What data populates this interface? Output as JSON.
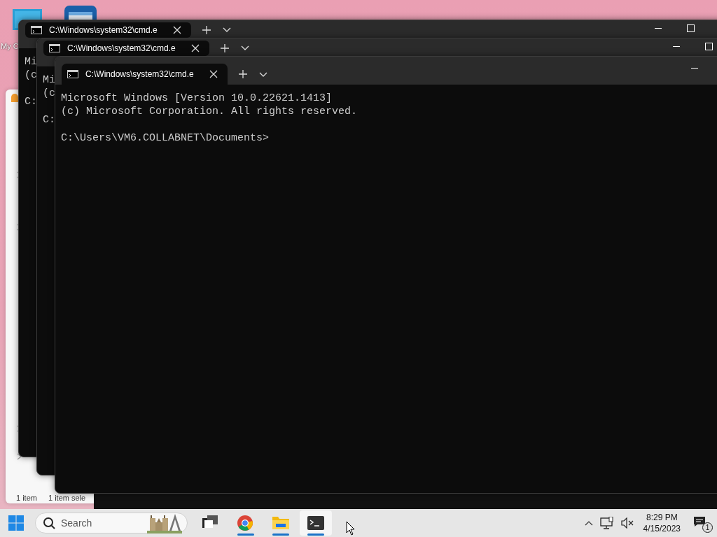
{
  "desktop": {
    "icons": [
      {
        "kind": "monitor",
        "label": "My C"
      },
      {
        "kind": "app"
      }
    ]
  },
  "explorer": {
    "status_items": [
      "1 item",
      "1 item sele"
    ]
  },
  "windows": [
    {
      "tabs": [
        {
          "title": "C:\\Windows\\system32\\cmd.e",
          "selected": true
        }
      ],
      "buttons": [
        {
          "kind": "minimize"
        },
        {
          "kind": "maximize"
        }
      ],
      "banner": [
        "Mi",
        "(c"
      ],
      "prompt": "C:"
    },
    {
      "tabs": [
        {
          "title": "C:\\Windows\\system32\\cmd.e",
          "selected": true
        }
      ],
      "buttons": [
        {
          "kind": "minimize"
        },
        {
          "kind": "maximize"
        }
      ],
      "banner": [
        "Mi",
        "(c"
      ],
      "prompt": "C:"
    },
    {
      "tabs": [
        {
          "title": "C:\\Windows\\system32\\cmd.e",
          "selected": true
        }
      ],
      "buttons": [
        {
          "kind": "minimize"
        }
      ],
      "banner": [
        "Microsoft Windows [Version 10.0.22621.1413]",
        "(c) Microsoft Corporation. All rights reserved."
      ],
      "prompt": "C:\\Users\\VM6.COLLABNET\\Documents>"
    }
  ],
  "taskbar": {
    "search": {
      "placeholder": "Search"
    },
    "apps": [
      {
        "kind": "taskview",
        "running": false,
        "active": false
      },
      {
        "kind": "chrome",
        "running": true,
        "active": false
      },
      {
        "kind": "folder",
        "running": true,
        "active": false
      },
      {
        "kind": "terminal",
        "running": true,
        "active": true
      }
    ],
    "tray": {
      "time": "8:29 PM",
      "date": "4/15/2023",
      "notifications": "1"
    }
  }
}
